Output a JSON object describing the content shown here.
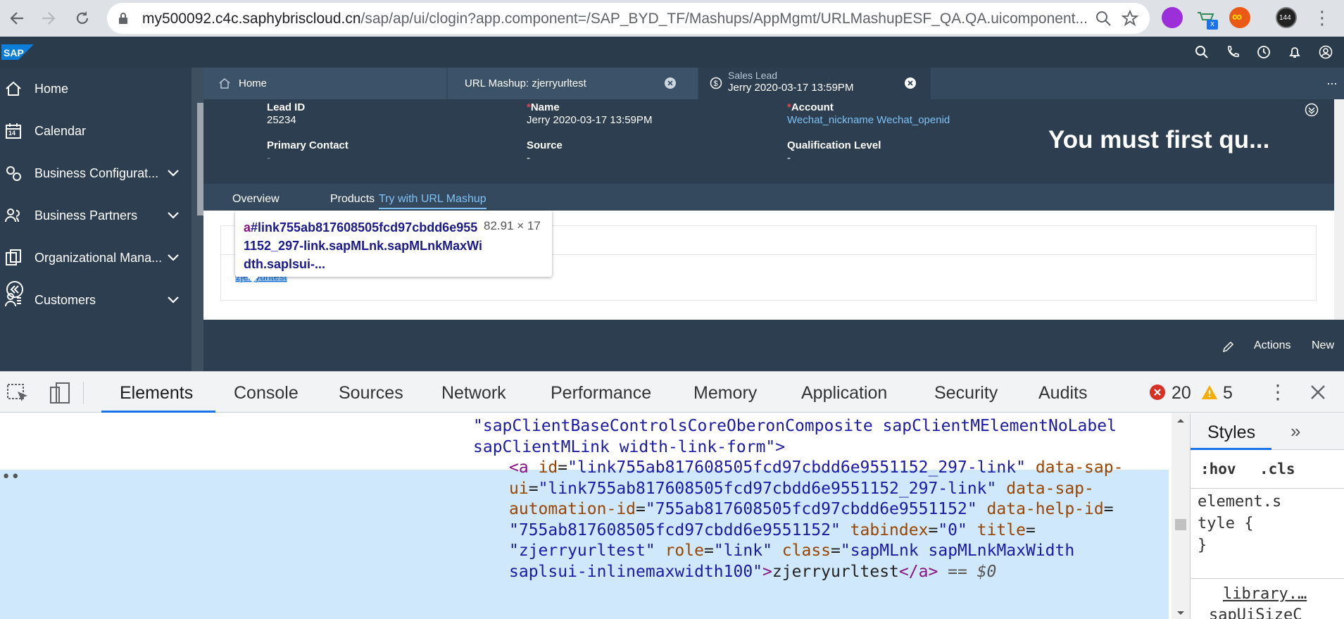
{
  "browser": {
    "url_main": "my500092.c4c.saphybriscloud.cn",
    "url_rest": "/sap/ap/ui/clogin?app.component=/SAP_BYD_TF/Mashups/AppMgmt/URLMashupESF_QA.QA.uicomponent...",
    "profile_badge": "144",
    "ext_badge": "x"
  },
  "shell": {
    "logo": "SAP",
    "icons": [
      "search-icon",
      "phone-icon",
      "clock-icon",
      "bell-icon",
      "user-icon"
    ]
  },
  "sidebar": {
    "items": [
      {
        "label": "Home",
        "icon": "home-icon",
        "expandable": false
      },
      {
        "label": "Calendar",
        "icon": "calendar-icon",
        "expandable": false,
        "day": "14"
      },
      {
        "label": "Business Configurat...",
        "icon": "config-icon",
        "expandable": true
      },
      {
        "label": "Business Partners",
        "icon": "partners-icon",
        "expandable": true
      },
      {
        "label": "Organizational Mana...",
        "icon": "org-icon",
        "expandable": true
      },
      {
        "label": "Customers",
        "icon": "customers-icon",
        "expandable": true
      }
    ]
  },
  "tabs": {
    "home": "Home",
    "url_mashup": "URL Mashup: zjerryurltest",
    "lead_type": "Sales Lead",
    "lead_title": "Jerry 2020-03-17 13:59PM",
    "more": "···"
  },
  "header": {
    "lead_id_label": "Lead ID",
    "lead_id_value": "25234",
    "name_label": "Name",
    "name_value": "Jerry 2020-03-17 13:59PM",
    "account_label": "Account",
    "account_value": "Wechat_nickname Wechat_openid",
    "primary_contact_label": "Primary Contact",
    "primary_contact_value": "-",
    "source_label": "Source",
    "source_value": "-",
    "qualification_label": "Qualification Level",
    "qualification_value": "-",
    "message": "You must first qu..."
  },
  "subtabs": {
    "overview": "Overview",
    "products": "Products",
    "mashup": "Try with URL Mashup"
  },
  "content": {
    "link_text": "zjerryurltest"
  },
  "tooltip": {
    "tag": "a",
    "selector": "#link755ab817608505fcd97cbdd6e9551152_297-link.sapMLnk.sapMLnkMaxWidth.saplsui-...",
    "dimensions": "82.91 × 17"
  },
  "footer": {
    "actions": "Actions",
    "new": "New"
  },
  "devtools": {
    "tabs": [
      "Elements",
      "Console",
      "Sources",
      "Network",
      "Performance",
      "Memory",
      "Application",
      "Security",
      "Audits"
    ],
    "errors": "20",
    "warnings": "5",
    "code": {
      "line1": "\"sapClientBaseControlsCoreOberonComposite sapClientMElementNoLabel",
      "line2": "sapClientMLink width-link-form\">",
      "a_open": "<a",
      "id_attr": "id",
      "id_val": "\"link755ab817608505fcd97cbdd6e9551152_297-link\"",
      "sapui_attr": "data-sap-",
      "sapui_attr2": "ui",
      "sapui_val": "\"link755ab817608505fcd97cbdd6e9551152_297-link\"",
      "autoid_attr": "data-sap-",
      "autoid_attr2": "automation-id",
      "autoid_val": "\"755ab817608505fcd97cbdd6e9551152\"",
      "helpid_attr": "data-help-id",
      "helpid_val": "\"755ab817608505fcd97cbdd6e9551152\"",
      "tabindex_attr": "tabindex",
      "tabindex_val": "\"0\"",
      "title_attr": "title",
      "title_val": "\"zjerryurltest\"",
      "role_attr": "role",
      "role_val": "\"link\"",
      "class_attr": "class",
      "class_val1": "\"sapMLnk sapMLnkMaxWidth",
      "class_val2": "saplsui-inlinemaxwidth100\"",
      "text": "zjerryurltest",
      "a_close": "</a>",
      "eq": "== $0",
      "dots": "••"
    },
    "styles": {
      "tab": "Styles",
      "more": "»",
      "hov": ":hov",
      "cls": ".cls",
      "rule1": "element.s",
      "rule2": "tyle {",
      "rule3": "}",
      "lib": "library.…",
      "lib_sel": "sapUiSizeC"
    }
  },
  "colors": {
    "sap_blue": "#0a6ed1",
    "shell_bg": "#2c3e50",
    "link": "#7ec2f5",
    "devtools_selection": "#cfe8fc"
  }
}
